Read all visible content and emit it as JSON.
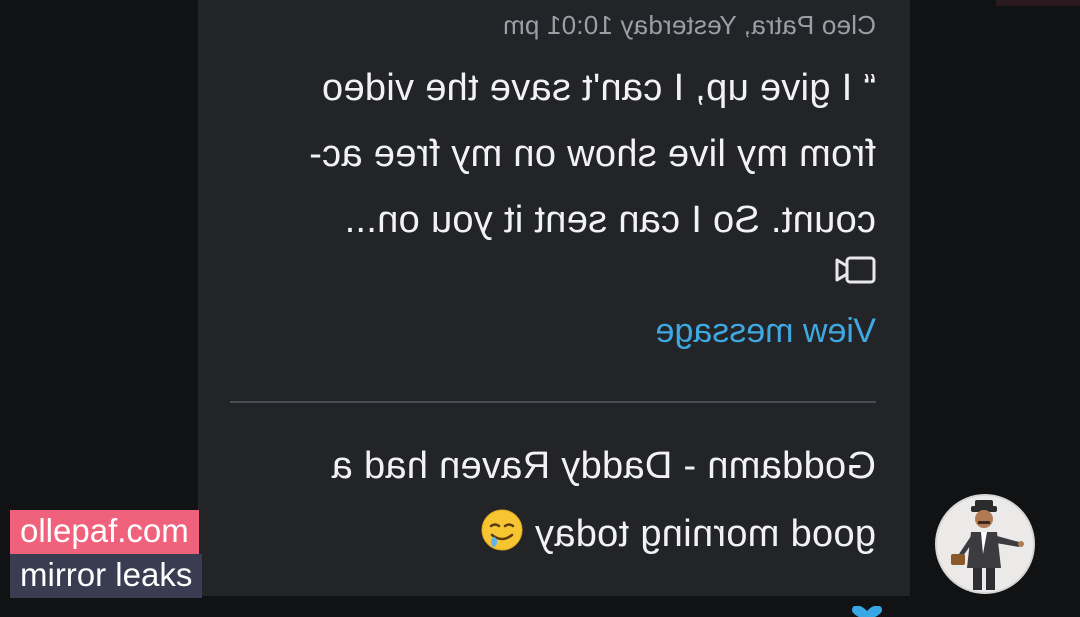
{
  "message": {
    "quoted": {
      "author": "Cleo Patra",
      "time": "Yesterday 10:01 pm",
      "meta_line": "Cleo Patra, Yesterday 10:01 pm",
      "text_line1": "“ I give up, I can't save the video",
      "text_line2": "from my live show on my free ac-",
      "text_line3": "count. So I can sent it you on...",
      "attachment_icon": "video-camera-icon",
      "view_link": "View message"
    },
    "reply": {
      "line1": "Goddamn - Daddy Raven had a",
      "line2": "good morning today",
      "emoji": "drooling-face-emoji"
    }
  },
  "watermark": {
    "site": "ollepaf.com",
    "tagline": "mirror leaks"
  },
  "colors": {
    "background": "#111214",
    "bubble": "#222428",
    "link": "#3ea8e0",
    "badge_pink": "#f0627c",
    "badge_dark": "#3a3d52"
  }
}
